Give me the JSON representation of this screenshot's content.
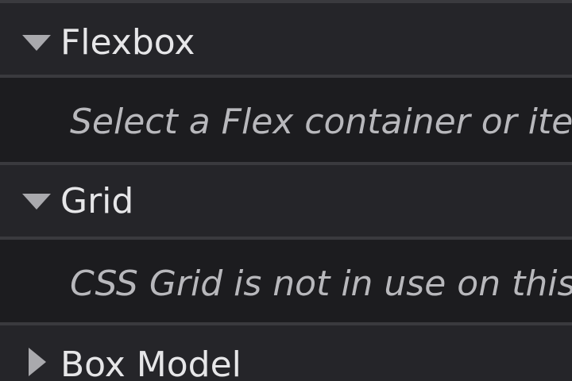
{
  "colors": {
    "header_bg": "#252529",
    "body_bg": "#1c1c1f",
    "divider": "#3a3a3e",
    "header_text": "#e6e6e8",
    "message_text": "#b8b8bc",
    "twisty": "#a9a9ad"
  },
  "sections": [
    {
      "label": "Flexbox",
      "expanded": true,
      "twisty_icon": "triangle-down-icon",
      "message": "Select a Flex container or item to continue."
    },
    {
      "label": "Grid",
      "expanded": true,
      "twisty_icon": "triangle-down-icon",
      "message": "CSS Grid is not in use on this page"
    },
    {
      "label": "Box Model",
      "expanded": false,
      "twisty_icon": "triangle-right-icon"
    }
  ]
}
